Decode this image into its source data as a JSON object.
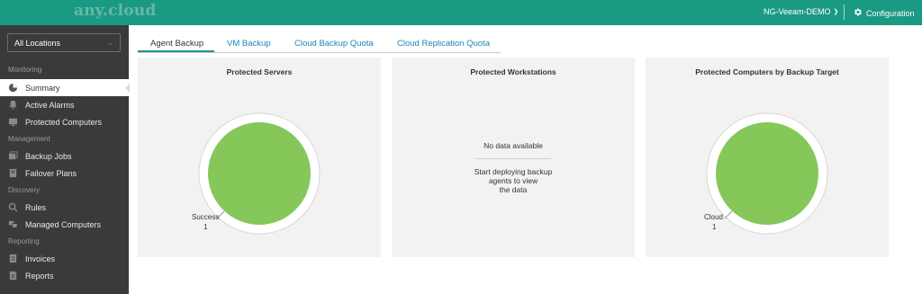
{
  "header": {
    "logo": "any.cloud",
    "tenant": "NG-Veeam-DEMO",
    "config_label": "Configuration"
  },
  "sidebar": {
    "location_select": "All Locations",
    "sections": {
      "monitoring": "Monitoring",
      "management": "Management",
      "discovery": "Discovery",
      "reporting": "Reporting"
    },
    "items": [
      {
        "label": "Summary",
        "icon": "pie-chart-icon",
        "active": true
      },
      {
        "label": "Active Alarms",
        "icon": "bell-icon"
      },
      {
        "label": "Protected Computers",
        "icon": "computer-icon"
      },
      {
        "label": "Backup Jobs",
        "icon": "backup-jobs-icon"
      },
      {
        "label": "Failover Plans",
        "icon": "failover-icon"
      },
      {
        "label": "Rules",
        "icon": "rules-icon"
      },
      {
        "label": "Managed Computers",
        "icon": "managed-computers-icon"
      },
      {
        "label": "Invoices",
        "icon": "invoice-icon"
      },
      {
        "label": "Reports",
        "icon": "report-icon"
      }
    ]
  },
  "tabs": [
    {
      "label": "Agent Backup",
      "active": true
    },
    {
      "label": "VM Backup"
    },
    {
      "label": "Cloud Backup Quota"
    },
    {
      "label": "Cloud Replication Quota"
    }
  ],
  "panels": {
    "servers": {
      "title": "Protected Servers",
      "segment_label": "Success",
      "segment_value": "1"
    },
    "workstations": {
      "title": "Protected Workstations",
      "no_data": "No data available",
      "hint_line1": "Start deploying backup",
      "hint_line2": "agents to view",
      "hint_line3": "the data"
    },
    "targets": {
      "title": "Protected Computers by Backup Target",
      "segment_label": "Cloud",
      "segment_value": "1"
    }
  },
  "colors": {
    "accent": "#1b9a83",
    "link": "#1b87b5",
    "success_green": "#86c75a",
    "sidebar_bg": "#3a3a3a"
  }
}
